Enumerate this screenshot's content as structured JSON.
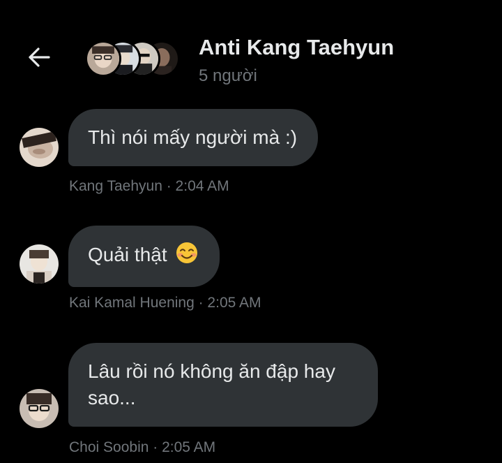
{
  "header": {
    "back_icon": "arrow-left-icon",
    "title": "Anti Kang Taehyun",
    "subtitle": "5 người",
    "group_avatars": [
      "member-1",
      "member-2",
      "member-3",
      "member-4"
    ]
  },
  "messages": [
    {
      "sender": "Kang Taehyun",
      "text": "Thì nói mấy người mà :)",
      "meta": "Kang Taehyun · 2:04 AM"
    },
    {
      "sender": "Kai Kamal Huening",
      "text": "Quải thật",
      "emoji": "smiling-face-icon",
      "meta": "Kai Kamal Huening · 2:05 AM"
    },
    {
      "sender": "Choi Soobin",
      "text": "Lâu rồi nó không ăn đập hay sao...",
      "meta": "Choi Soobin · 2:05 AM"
    }
  ],
  "colors": {
    "background": "#000000",
    "bubble": "#2f3336",
    "text": "#e7e9ea",
    "muted": "#71767b"
  }
}
